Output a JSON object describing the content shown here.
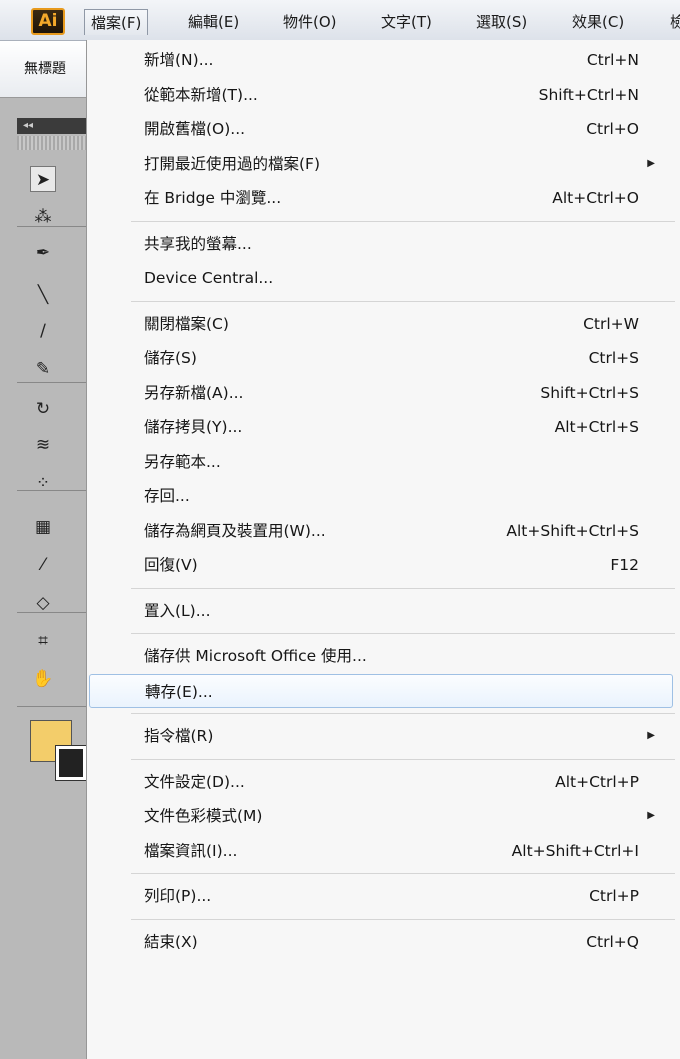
{
  "app": {
    "logo": "Ai"
  },
  "menubar": {
    "items": [
      "檔案(F)",
      "編輯(E)",
      "物件(O)",
      "文字(T)",
      "選取(S)",
      "效果(C)",
      "檢"
    ],
    "active_index": 0
  },
  "document": {
    "tab_label": "無標題"
  },
  "toolbar": {
    "header_glyph": "◂◂",
    "tools": [
      {
        "name": "selection-tool-icon",
        "glyph": "➤"
      },
      {
        "name": "magic-wand-tool-icon",
        "glyph": "⁂"
      },
      {
        "name": "pen-tool-icon",
        "glyph": "✒"
      },
      {
        "name": "line-tool-icon",
        "glyph": "╲"
      },
      {
        "name": "paintbrush-tool-icon",
        "glyph": "∕"
      },
      {
        "name": "blob-brush-tool-icon",
        "glyph": "✎"
      },
      {
        "name": "rotate-tool-icon",
        "glyph": "↻"
      },
      {
        "name": "warp-tool-icon",
        "glyph": "≋"
      },
      {
        "name": "symbol-sprayer-tool-icon",
        "glyph": "⁘"
      },
      {
        "name": "graph-tool-icon",
        "glyph": "▦"
      },
      {
        "name": "eyedropper-tool-icon",
        "glyph": "⁄"
      },
      {
        "name": "live-paint-tool-icon",
        "glyph": "◇"
      },
      {
        "name": "artboard-tool-icon",
        "glyph": "⌗"
      },
      {
        "name": "hand-tool-icon",
        "glyph": "✋"
      }
    ],
    "fill_color": "#f3cd6a",
    "stroke_color": "#222222"
  },
  "file_menu": {
    "groups": [
      [
        {
          "label": "新增(N)...",
          "shortcut": "Ctrl+N"
        },
        {
          "label": "從範本新增(T)...",
          "shortcut": "Shift+Ctrl+N"
        },
        {
          "label": "開啟舊檔(O)...",
          "shortcut": "Ctrl+O"
        },
        {
          "label": "打開最近使用過的檔案(F)",
          "shortcut": "",
          "submenu": true
        },
        {
          "label": "在 Bridge 中瀏覽...",
          "shortcut": "Alt+Ctrl+O"
        }
      ],
      [
        {
          "label": "共享我的螢幕...",
          "shortcut": ""
        },
        {
          "label": "Device Central...",
          "shortcut": ""
        }
      ],
      [
        {
          "label": "關閉檔案(C)",
          "shortcut": "Ctrl+W"
        },
        {
          "label": "儲存(S)",
          "shortcut": "Ctrl+S"
        },
        {
          "label": "另存新檔(A)...",
          "shortcut": "Shift+Ctrl+S"
        },
        {
          "label": "儲存拷貝(Y)...",
          "shortcut": "Alt+Ctrl+S"
        },
        {
          "label": "另存範本...",
          "shortcut": ""
        },
        {
          "label": "存回...",
          "shortcut": ""
        },
        {
          "label": "儲存為網頁及裝置用(W)...",
          "shortcut": "Alt+Shift+Ctrl+S"
        },
        {
          "label": "回復(V)",
          "shortcut": "F12"
        }
      ],
      [
        {
          "label": "置入(L)...",
          "shortcut": ""
        }
      ],
      [
        {
          "label": "儲存供 Microsoft Office 使用...",
          "shortcut": ""
        },
        {
          "label": "轉存(E)...",
          "shortcut": "",
          "highlighted": true
        }
      ],
      [
        {
          "label": "指令檔(R)",
          "shortcut": "",
          "submenu": true
        }
      ],
      [
        {
          "label": "文件設定(D)...",
          "shortcut": "Alt+Ctrl+P"
        },
        {
          "label": "文件色彩模式(M)",
          "shortcut": "",
          "submenu": true
        },
        {
          "label": "檔案資訊(I)...",
          "shortcut": "Alt+Shift+Ctrl+I"
        }
      ],
      [
        {
          "label": "列印(P)...",
          "shortcut": "Ctrl+P"
        }
      ],
      [
        {
          "label": "結束(X)",
          "shortcut": "Ctrl+Q"
        }
      ]
    ],
    "submenu_arrow": "▶"
  }
}
